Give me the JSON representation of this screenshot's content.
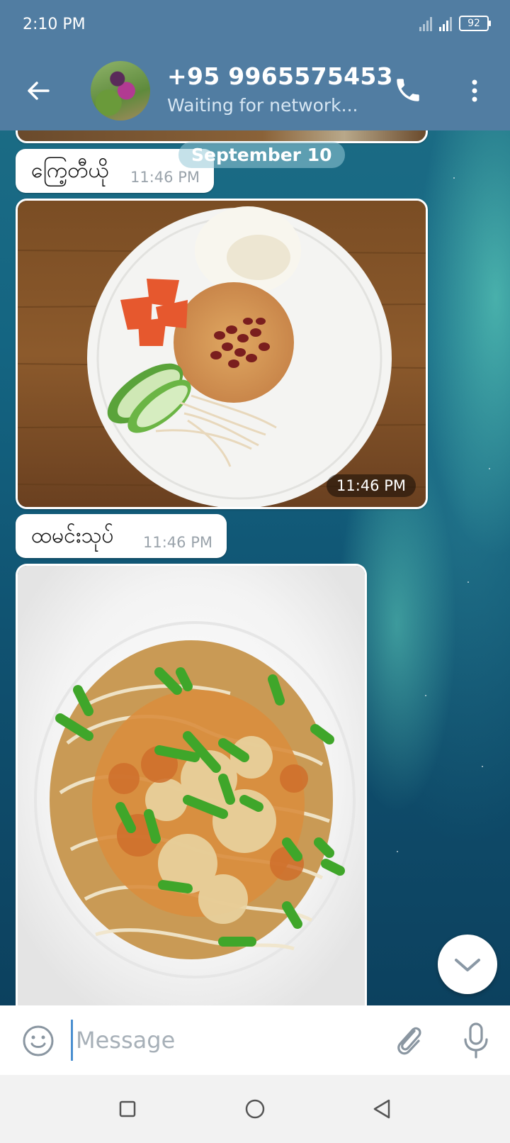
{
  "status_bar": {
    "time": "2:10 PM",
    "battery": "92"
  },
  "header": {
    "contact_name": "+95 9965575453",
    "contact_status": "Waiting for network..."
  },
  "date_chip": "September 10",
  "messages": [
    {
      "text": "ကြေ့တီယို",
      "time": "11:46 PM"
    },
    {
      "photo_time": "11:46 PM"
    },
    {
      "text": "ထမင်းသုပ်",
      "time": "11:46 PM"
    }
  ],
  "composer": {
    "placeholder": "Message"
  },
  "colors": {
    "header": "#517da2",
    "bubble": "#ffffff",
    "accent": "#4a8fd0"
  },
  "icons": [
    "back-arrow-icon",
    "phone-icon",
    "more-vert-icon",
    "chevron-down-icon",
    "emoji-icon",
    "paperclip-icon",
    "microphone-icon",
    "square-icon",
    "circle-icon",
    "triangle-back-icon"
  ]
}
